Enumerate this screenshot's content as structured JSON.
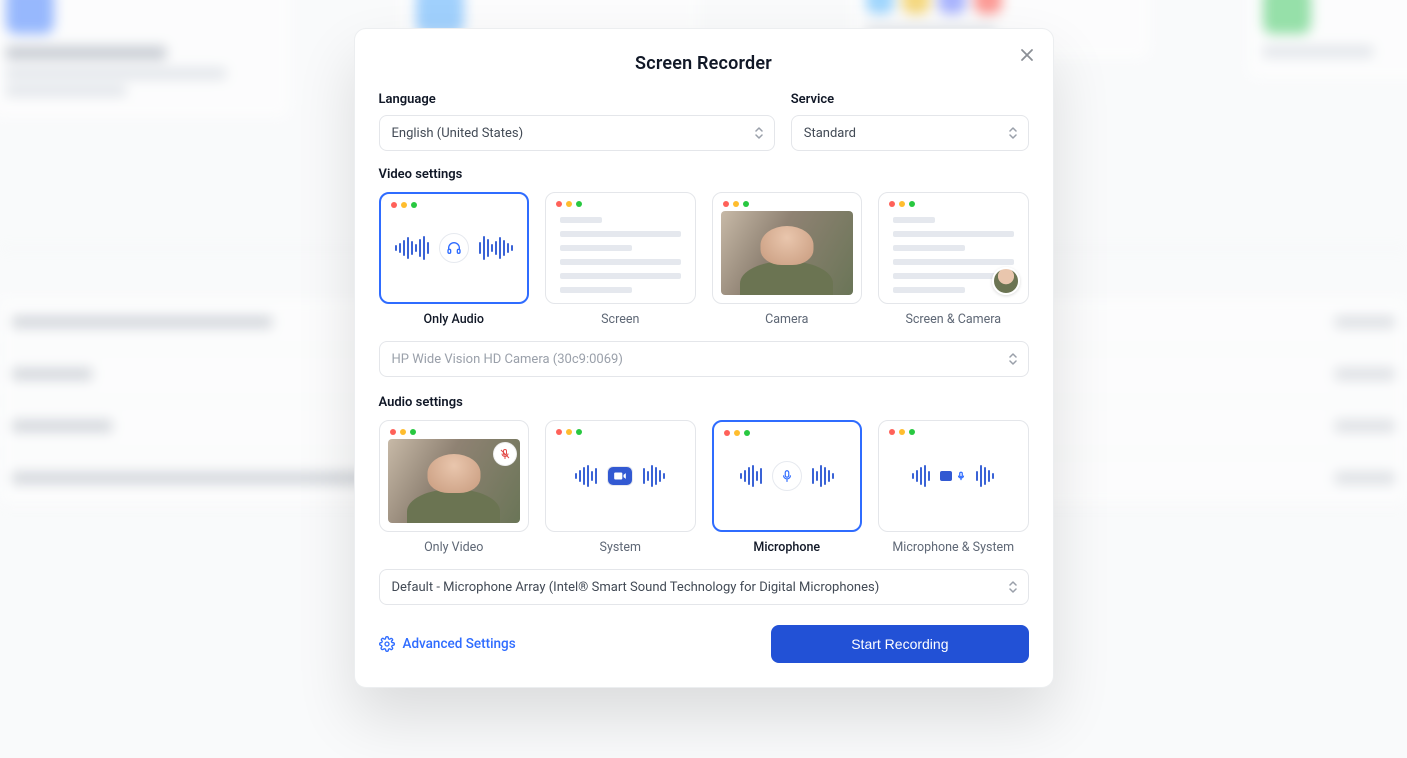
{
  "modal_title": "Screen Recorder",
  "labels": {
    "language": "Language",
    "service": "Service",
    "video_settings": "Video settings",
    "audio_settings": "Audio settings",
    "advanced_settings": "Advanced Settings"
  },
  "language_selected": "English (United States)",
  "service_selected": "Standard",
  "camera_device": "HP Wide Vision HD Camera (30c9:0069)",
  "mic_device": "Default - Microphone Array (Intel® Smart Sound Technology for Digital Microphones)",
  "video_options": {
    "only_audio": "Only Audio",
    "screen": "Screen",
    "camera": "Camera",
    "screen_camera": "Screen & Camera"
  },
  "audio_options": {
    "only_video": "Only Video",
    "system": "System",
    "microphone": "Microphone",
    "mic_system": "Microphone & System"
  },
  "cta": "Start Recording"
}
